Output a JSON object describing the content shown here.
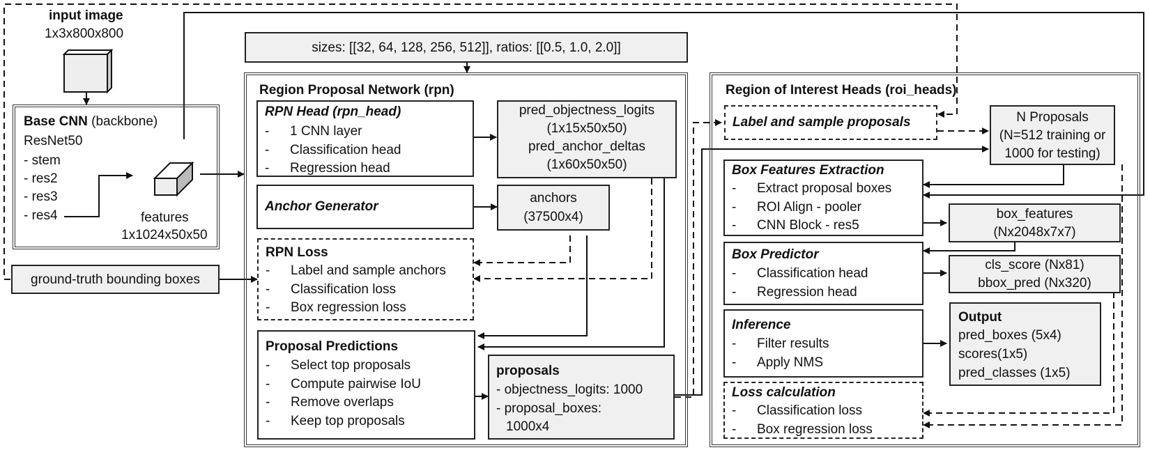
{
  "input": {
    "title": "input image",
    "shape": "1x3x800x800"
  },
  "backbone": {
    "title_bold": "Base CNN",
    "title_rest": " (backbone)",
    "model": "ResNet50",
    "stages": [
      "- stem",
      "- res2",
      "- res3",
      "- res4"
    ],
    "features_label": "features",
    "features_shape": "1x1024x50x50"
  },
  "ground_truth": {
    "label": "ground-truth bounding boxes"
  },
  "anchor_config": {
    "label": "sizes: [[32, 64, 128, 256, 512]], ratios: [[0.5, 1.0, 2.0]]"
  },
  "rpn": {
    "title": "Region Proposal Network (rpn)",
    "head": {
      "title": "RPN Head (rpn_head)",
      "items": [
        "1 CNN layer",
        "Classification head",
        "Regression head"
      ]
    },
    "head_output": {
      "lines": [
        "pred_objectness_logits",
        "(1x15x50x50)",
        "pred_anchor_deltas",
        "(1x60x50x50)"
      ]
    },
    "anchor_generator": {
      "title": "Anchor Generator"
    },
    "anchors": {
      "lines": [
        "anchors",
        "(37500x4)"
      ]
    },
    "loss": {
      "title": "RPN Loss",
      "items": [
        "Label and sample anchors",
        "Classification loss",
        "Box regression loss"
      ]
    },
    "proposal_predictions": {
      "title": "Proposal Predictions",
      "items": [
        "Select top proposals",
        "Compute pairwise IoU",
        "Remove overlaps",
        "Keep top proposals"
      ]
    },
    "proposals": {
      "title": "proposals",
      "items": [
        "- objectness_logits: 1000",
        "- proposal_boxes:",
        "  1000x4"
      ]
    }
  },
  "roi_heads": {
    "title": "Region of Interest Heads (roi_heads)",
    "label_sample": {
      "title": "Label and sample proposals"
    },
    "n_proposals": {
      "lines": [
        "N Proposals",
        "(N=512 training or",
        "1000 for testing)"
      ]
    },
    "box_features_extraction": {
      "title": "Box Features Extraction",
      "items": [
        "Extract proposal boxes",
        "ROI Align - pooler",
        "CNN Block - res5"
      ]
    },
    "box_features": {
      "lines": [
        "box_features",
        "(Nx2048x7x7)"
      ]
    },
    "box_predictor": {
      "title": "Box Predictor",
      "items": [
        "Classification head",
        "Regression head"
      ]
    },
    "predictor_output": {
      "lines": [
        "cls_score (Nx81)",
        "bbox_pred (Nx320)"
      ]
    },
    "inference": {
      "title": "Inference",
      "items": [
        "Filter results",
        "Apply NMS"
      ]
    },
    "output": {
      "title": "Output",
      "items": [
        "pred_boxes (5x4)",
        "scores(1x5)",
        "pred_classes (1x5)"
      ]
    },
    "loss": {
      "title": "Loss calculation",
      "items": [
        "Classification loss",
        "Box regression loss"
      ]
    }
  },
  "list_dash": "-"
}
